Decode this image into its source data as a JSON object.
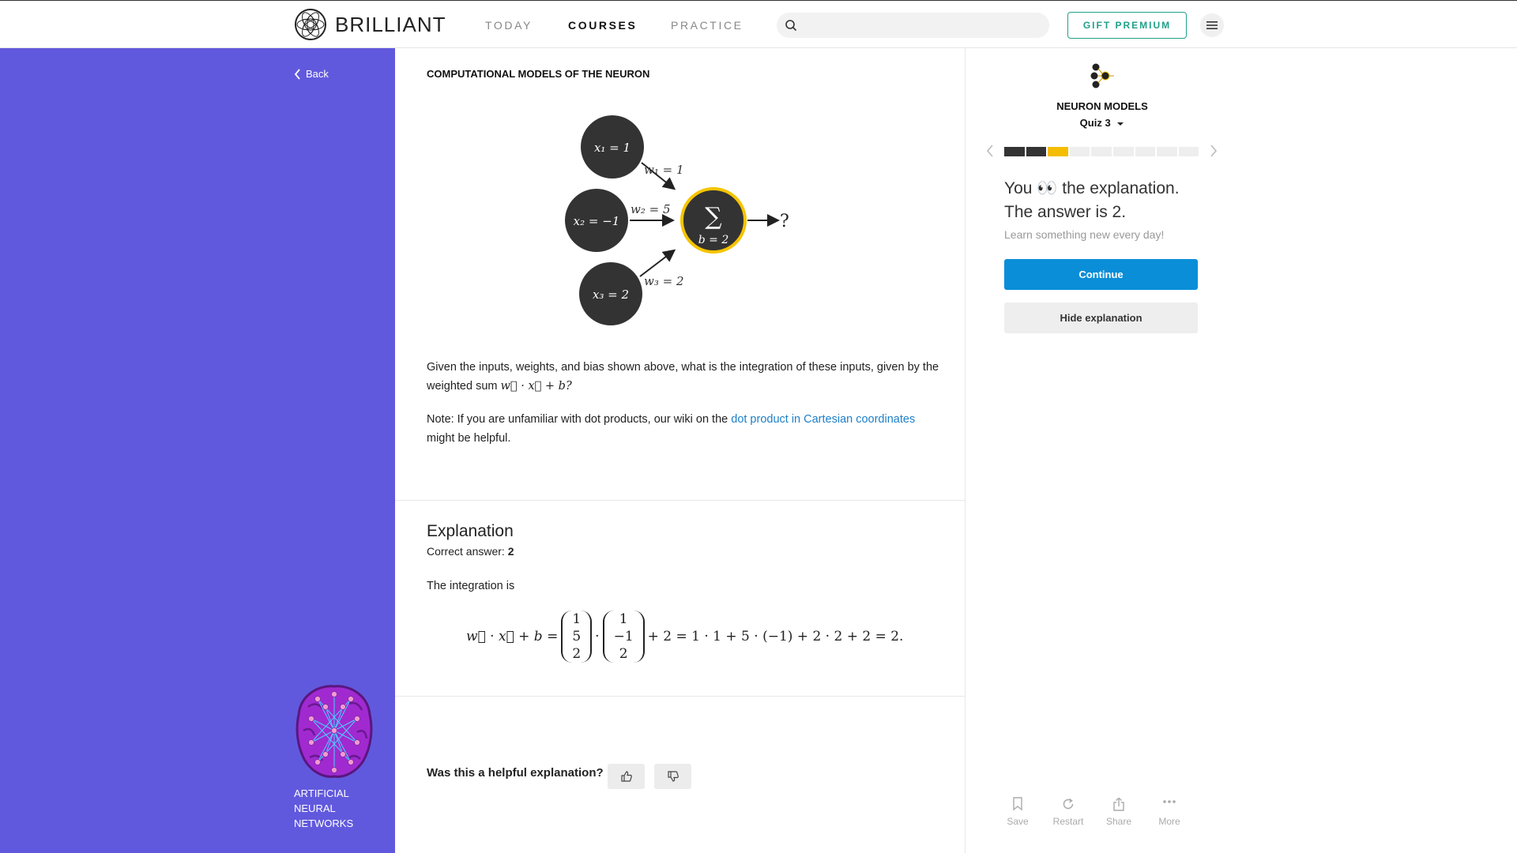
{
  "header": {
    "logo_text": "BRILLIANT",
    "nav": [
      "TODAY",
      "COURSES",
      "PRACTICE"
    ],
    "active_nav": "COURSES",
    "search_placeholder": "",
    "gift_label": "GIFT PREMIUM"
  },
  "sidebar": {
    "back_label": "Back",
    "course_name": "ARTIFICIAL NEURAL NETWORKS",
    "background_color": "#6159dd"
  },
  "main": {
    "section_title": "COMPUTATIONAL MODELS OF THE NEURON",
    "diagram": {
      "inputs": [
        "x₁ = 1",
        "x₂ = −1",
        "x₃ = 2"
      ],
      "weights": [
        "w₁ = 1",
        "w₂ = 5",
        "w₃ = 2"
      ],
      "sum_symbol": "∑",
      "bias": "b = 2",
      "output": "?"
    },
    "question_text": "Given the inputs, weights, and bias shown above, what is the integration of these inputs, given by the weighted sum",
    "question_math": "w⃗ · x⃗ + b?",
    "note_prefix": "Note: If you are unfamiliar with dot products, our wiki on the",
    "note_link": "dot product in Cartesian coordinates",
    "note_suffix": "might be helpful.",
    "explanation": {
      "title": "Explanation",
      "correct_label": "Correct answer:",
      "correct_value": "2",
      "intro": "The integration is",
      "lhs": "w⃗ · x⃗ + b =",
      "vector_w": [
        "1",
        "5",
        "2"
      ],
      "dot": "·",
      "vector_x": [
        "1",
        "−1",
        "2"
      ],
      "rhs": "+ 2 = 1 · 1 + 5 · (−1) + 2 · 2 + 2 = 2."
    },
    "feedback_question": "Was this a helpful explanation?"
  },
  "quiz_panel": {
    "topic": "NEURON MODELS",
    "quiz_label": "Quiz 3",
    "progress": [
      "done",
      "done",
      "current",
      "todo",
      "todo",
      "todo",
      "todo",
      "todo",
      "todo"
    ],
    "result_line1": "You 👀 the explanation.",
    "result_line2": "The answer is 2.",
    "tagline": "Learn something new every day!",
    "continue_label": "Continue",
    "hide_label": "Hide explanation",
    "actions": [
      "Save",
      "Restart",
      "Share",
      "More"
    ],
    "colors": {
      "done": "#333333",
      "current": "#f5bd00",
      "todo": "#eeeeee",
      "continue": "#0a8ed8"
    }
  }
}
